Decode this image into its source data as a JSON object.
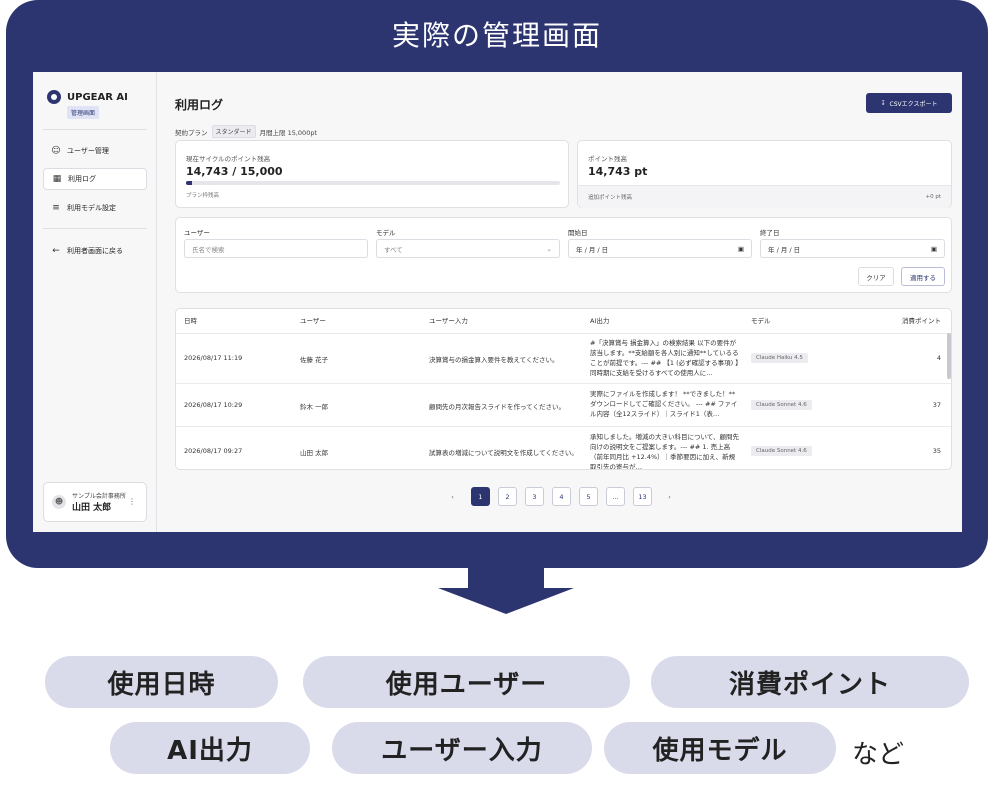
{
  "frame_title": "実際の管理画面",
  "brand": {
    "name": "UPGEAR AI",
    "badge": "管理画面"
  },
  "sidebar": {
    "items": [
      {
        "label": "ユーザー管理",
        "icon": "users-icon",
        "active": false
      },
      {
        "label": "利用ログ",
        "icon": "log-icon",
        "active": true
      },
      {
        "label": "利用モデル設定",
        "icon": "sliders-icon",
        "active": false
      }
    ],
    "back_label": "利用者画面に戻る",
    "user": {
      "org": "サンプル会計事務所",
      "name": "山田 太郎"
    }
  },
  "header": {
    "title": "利用ログ",
    "csv_button": "CSVエクスポート"
  },
  "plan": {
    "label": "契約プラン",
    "plan_name": "スタンダード",
    "limit": "月間上限 15,000pt"
  },
  "cycle_card": {
    "label": "現在サイクルのポイント残高",
    "value": "14,743 / 15,000",
    "progress": 0.017,
    "sub": "プラン枠残高"
  },
  "points_card": {
    "label": "ポイント残高",
    "value": "14,743 pt",
    "foot_label": "追加ポイント残高",
    "foot_value": "+0 pt"
  },
  "filters": {
    "user_label": "ユーザー",
    "user_placeholder": "氏名で検索",
    "model_label": "モデル",
    "model_value": "すべて",
    "start_label": "開始日",
    "start_value": "年 / 月 / 日",
    "end_label": "終了日",
    "end_value": "年 / 月 / 日",
    "clear_label": "クリア",
    "apply_label": "適用する"
  },
  "table": {
    "headers": [
      "日時",
      "ユーザー",
      "ユーザー入力",
      "AI出力",
      "モデル",
      "消費ポイント"
    ],
    "rows": [
      {
        "date": "2026/08/17 11:19",
        "user": "佐藤 花子",
        "input": "決算賞与の損金算入要件を教えてください。",
        "output": "#「決算賞与 損金算入」の検索結果 以下の要件が該当します。**支給額を各人別に通知**しているることが前提です。--- ## 【1 (必ず確認する事項) 】同時期に支給を受けるすべての使用人に…",
        "model": "Claude Haiku 4.5",
        "points": "4"
      },
      {
        "date": "2026/08/17 10:29",
        "user": "鈴木 一郎",
        "input": "顧問先の月次報告スライドを作ってください。",
        "output": "実際にファイルを作成します！ **できました！** ダウンロードしてご確認ください。 --- ## ファイル内容（全12スライド）｜スライド1（表…",
        "model": "Claude Sonnet 4.6",
        "points": "37"
      },
      {
        "date": "2026/08/17 09:27",
        "user": "山田 太郎",
        "input": "試算表の増減について説明文を作成してください。",
        "output": "承知しました。増減の大きい科目について、顧問先向けの説明文をご提案します。--- ## 1. 売上高（前年同月比 +12.4%）｜季節要因に加え、新規取引先の寄与が…",
        "model": "Claude Sonnet 4.6",
        "points": "35"
      }
    ]
  },
  "pagination": {
    "prev": "‹",
    "pages": [
      "1",
      "2",
      "3",
      "4",
      "5",
      "…",
      "13"
    ],
    "next": "›"
  },
  "tags": [
    "使用日時",
    "使用ユーザー",
    "消費ポイント",
    "AI出力",
    "ユーザー入力",
    "使用モデル"
  ],
  "tags_suffix": "など",
  "colors": {
    "navy": "#2c3570",
    "pill": "#d9dbeb"
  }
}
